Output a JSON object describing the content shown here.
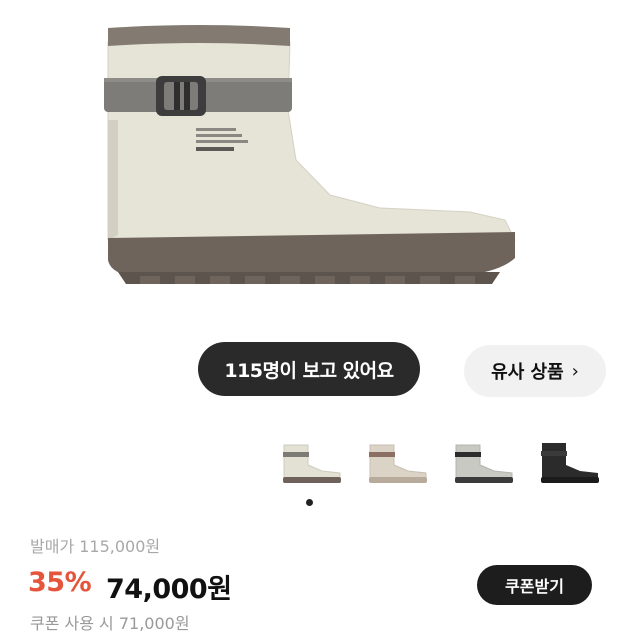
{
  "product": {
    "image_alt": "rubber boot",
    "boot_print": [
      "DUU / MARINE MODS",
      "PRODUCT NO. ST-027",
      "STYLE : RUBBER BOOTS",
      "MADESTAR"
    ]
  },
  "viewers": {
    "label": "115명이 보고 있어요"
  },
  "similar": {
    "label": "유사 상품",
    "icon": "chevron-right-icon"
  },
  "thumbnails": [
    {
      "color_name": "cream",
      "colors": {
        "shaft": "#e3e0d4",
        "sole": "#6e625a",
        "strap": "#7d7b76"
      }
    },
    {
      "color_name": "beige",
      "colors": {
        "shaft": "#dbd3c6",
        "sole": "#b9ab9c",
        "strap": "#8c6f63"
      }
    },
    {
      "color_name": "gray",
      "colors": {
        "shaft": "#c9c9c4",
        "sole": "#3b3b3b",
        "strap": "#2c2c2c"
      }
    },
    {
      "color_name": "black",
      "colors": {
        "shaft": "#2b2b2b",
        "sole": "#1b1b1b",
        "strap": "#3a3a3a"
      }
    }
  ],
  "carousel": {
    "active_index": 0
  },
  "pricing": {
    "list_price": "발매가 115,000원",
    "discount": "35%",
    "price": "74,000원",
    "coupon_label": "쿠폰받기",
    "partial_line": "쿠폰 사용 시 71,000원"
  },
  "colors": {
    "discount": "#e4553b",
    "dark_button": "#1d1d1d",
    "similar_bg": "#f1f1f1"
  }
}
